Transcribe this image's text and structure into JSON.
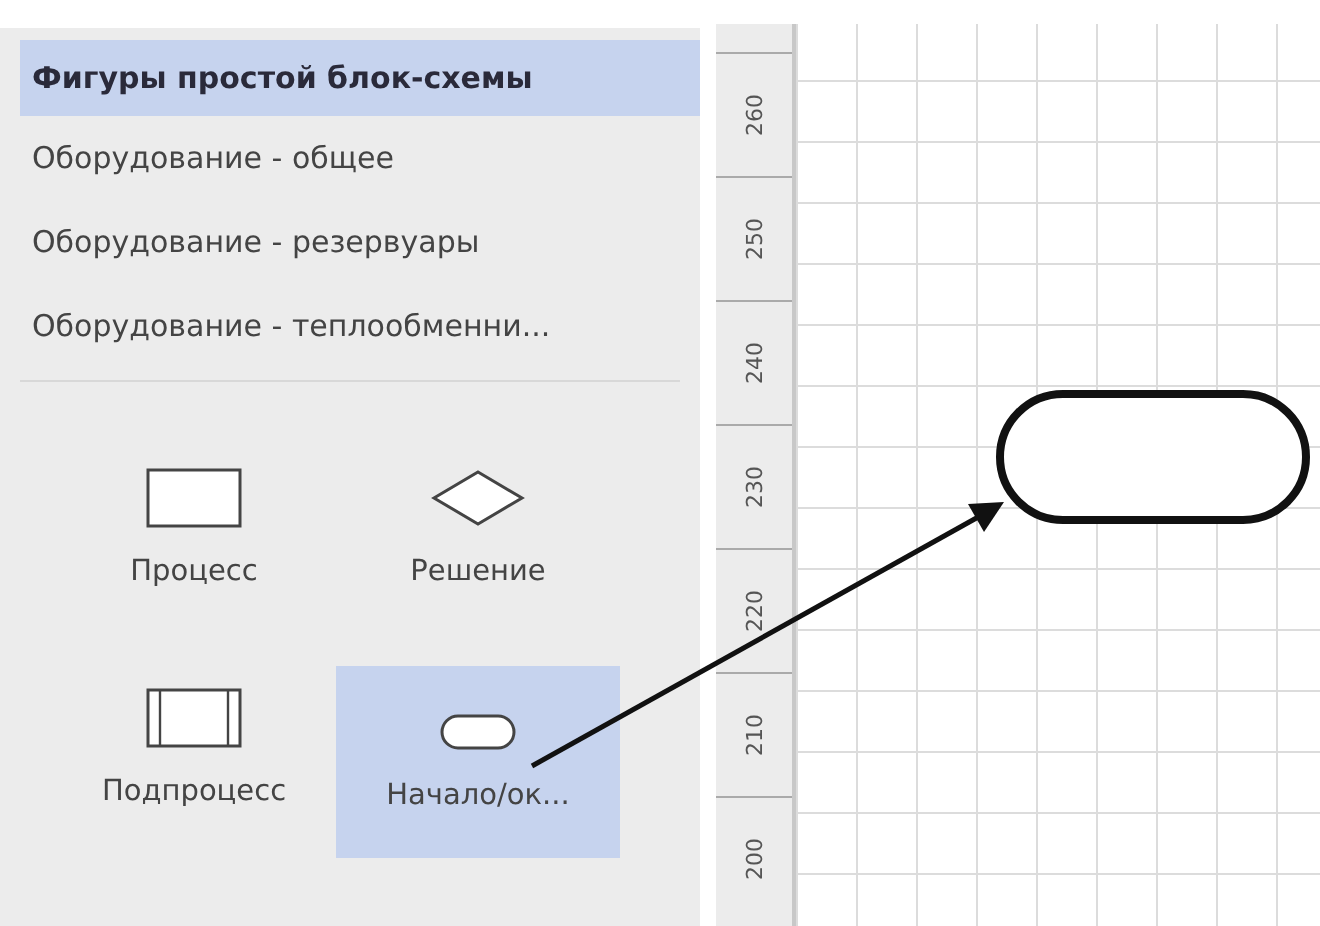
{
  "stencils": [
    {
      "label": "Фигуры простой блок-схемы",
      "selected": true
    },
    {
      "label": "Оборудование - общее",
      "selected": false
    },
    {
      "label": "Оборудование - резервуары",
      "selected": false
    },
    {
      "label": "Оборудование - теплообменни...",
      "selected": false
    }
  ],
  "shapes": [
    {
      "kind": "process",
      "label": "Процесс",
      "selected": false
    },
    {
      "kind": "decision",
      "label": "Решение",
      "selected": false
    },
    {
      "kind": "subprocess",
      "label": "Подпроцесс",
      "selected": false
    },
    {
      "kind": "terminator",
      "label": "Начало/ок...",
      "selected": true
    }
  ],
  "ruler": [
    "260",
    "250",
    "240",
    "230",
    "220",
    "210",
    "200"
  ],
  "canvas": {
    "shapes": [
      {
        "kind": "terminator"
      }
    ],
    "connectors": [
      {
        "kind": "arrow"
      }
    ]
  }
}
